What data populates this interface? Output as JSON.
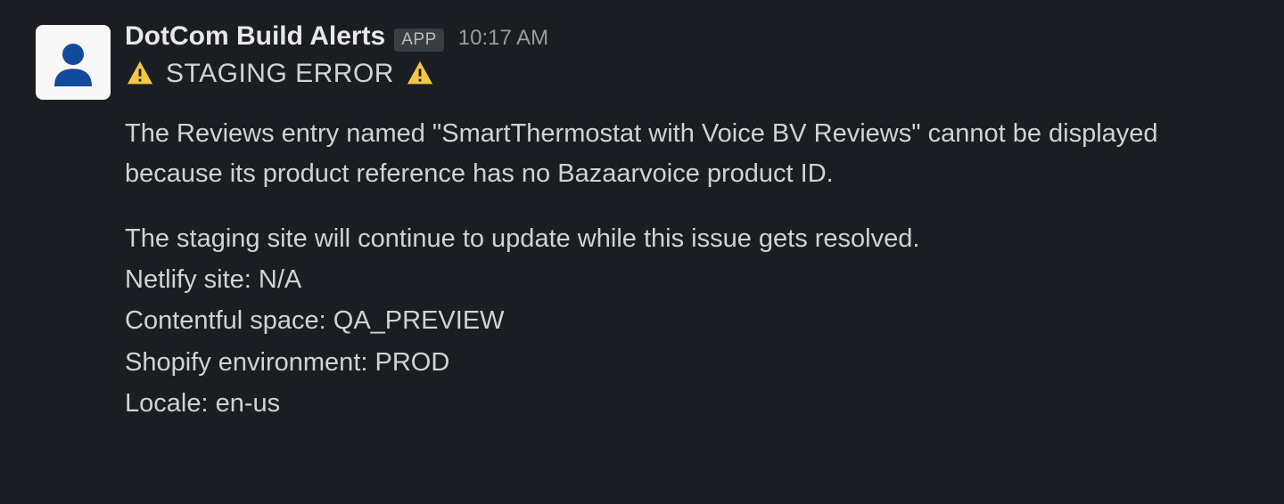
{
  "message": {
    "author": "DotCom Build Alerts",
    "app_badge": "APP",
    "timestamp": "10:17 AM",
    "status_text": "STAGING ERROR",
    "body_paragraph_1": "The Reviews entry named \"SmartThermostat with Voice BV Reviews\" cannot be displayed because its product reference has no Bazaarvoice product ID.",
    "body_paragraph_2": "The staging site will continue to update while this issue gets resolved.",
    "meta": {
      "netlify_label": "Netlify site:",
      "netlify_value": "N/A",
      "contentful_label": "Contentful space:",
      "contentful_value": "QA_PREVIEW",
      "shopify_label": "Shopify environment:",
      "shopify_value": "PROD",
      "locale_label": "Locale:",
      "locale_value": "en-us"
    }
  }
}
